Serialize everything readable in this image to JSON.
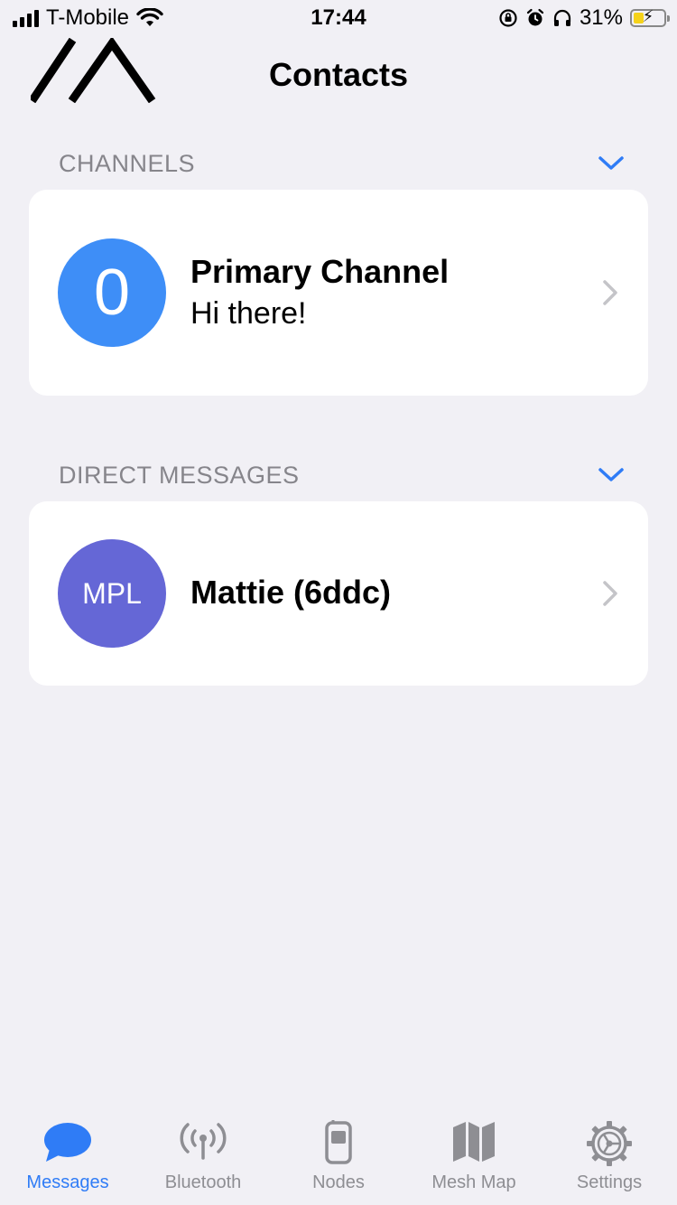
{
  "status_bar": {
    "carrier": "T-Mobile",
    "time": "17:44",
    "battery_percent": "31%",
    "battery_level": 0.31,
    "icons": [
      "signal-icon",
      "wifi-icon",
      "orientation-lock-icon",
      "alarm-icon",
      "headphones-icon",
      "battery-icon"
    ]
  },
  "nav": {
    "title": "Contacts",
    "logo_icon": "meshtastic-logo"
  },
  "sections": {
    "channels": {
      "title": "CHANNELS",
      "items": [
        {
          "avatar_text": "0",
          "avatar_color": "#3e8ef7",
          "title": "Primary Channel",
          "subtitle": "Hi there!"
        }
      ]
    },
    "direct_messages": {
      "title": "DIRECT MESSAGES",
      "items": [
        {
          "avatar_text": "MPL",
          "avatar_color": "#6567d6",
          "title": "Mattie (6ddc)"
        }
      ]
    }
  },
  "tab_bar": {
    "active_color": "#2f7cf6",
    "inactive_color": "#8e8e93",
    "tabs": [
      {
        "label": "Messages",
        "icon": "messages-icon",
        "active": true
      },
      {
        "label": "Bluetooth",
        "icon": "bluetooth-antenna-icon",
        "active": false
      },
      {
        "label": "Nodes",
        "icon": "nodes-device-icon",
        "active": false
      },
      {
        "label": "Mesh Map",
        "icon": "map-icon",
        "active": false
      },
      {
        "label": "Settings",
        "icon": "settings-gear-icon",
        "active": false
      }
    ]
  }
}
